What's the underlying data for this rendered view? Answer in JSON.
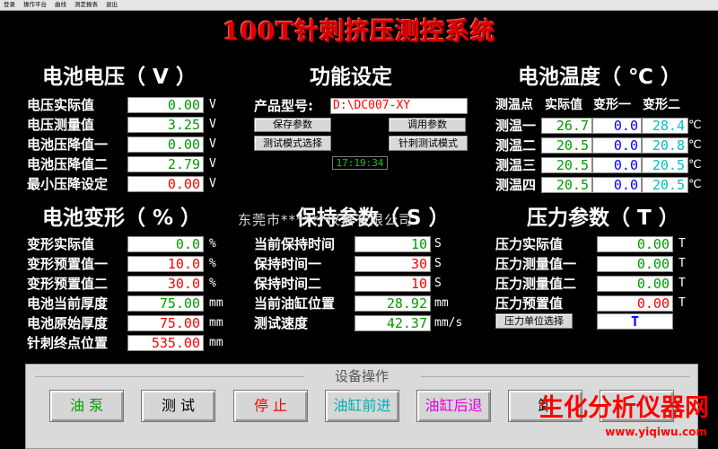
{
  "menu": [
    "登录",
    "操作平台",
    "曲线",
    "测定报表",
    "退出"
  ],
  "title": "100T针刺挤压测控系统",
  "voltage": {
    "title": "电池电压（ V ）",
    "rows": [
      {
        "label": "电压实际值",
        "value": "0.00",
        "unit": "V"
      },
      {
        "label": "电压测量值",
        "value": "3.25",
        "unit": "V"
      },
      {
        "label": "电池压降值一",
        "value": "0.00",
        "unit": "V"
      },
      {
        "label": "电池压降值二",
        "value": "2.79",
        "unit": "V"
      },
      {
        "label": "最小压降设定",
        "value": "0.00",
        "unit": "V"
      }
    ]
  },
  "function": {
    "title": "功能设定",
    "model_label": "产品型号:",
    "model_value": "D:\\DC007-XY",
    "save_button": "保存参数",
    "load_button": "调用参数",
    "test_mode_select": "测试模式选择",
    "test_mode_value": "针刺测试模式",
    "clock": "17:19:34"
  },
  "temperature": {
    "title": "电池温度（ ℃ ）",
    "headers": [
      "测温点",
      "实际值",
      "变形一",
      "变形二"
    ],
    "unit": "℃",
    "rows": [
      {
        "label": "测温一",
        "actual": "26.7",
        "deform1": "0.0",
        "deform2": "28.4"
      },
      {
        "label": "测温二",
        "actual": "20.5",
        "deform1": "0.0",
        "deform2": "20.8"
      },
      {
        "label": "测温三",
        "actual": "20.5",
        "deform1": "0.0",
        "deform2": "20.5"
      },
      {
        "label": "测温四",
        "actual": "20.5",
        "deform1": "0.0",
        "deform2": "20.5"
      }
    ]
  },
  "deformation": {
    "title": "电池变形（ % ）",
    "rows": [
      {
        "label": "变形实际值",
        "value": "0.0",
        "unit": "%"
      },
      {
        "label": "变形预置值一",
        "value": "10.0",
        "unit": "%"
      },
      {
        "label": "变形预置值二",
        "value": "30.0",
        "unit": "%"
      },
      {
        "label": "电池当前厚度",
        "value": "75.00",
        "unit": "mm"
      },
      {
        "label": "电池原始厚度",
        "value": "75.00",
        "unit": "mm"
      },
      {
        "label": "针刺终点位置",
        "value": "535.00",
        "unit": "mm"
      }
    ]
  },
  "hold": {
    "title": "保持参数（ S ）",
    "rows": [
      {
        "label": "当前保持时间",
        "value": "10",
        "unit": "S"
      },
      {
        "label": "保持时间一",
        "value": "30",
        "unit": "S"
      },
      {
        "label": "保持时间二",
        "value": "10",
        "unit": "S"
      },
      {
        "label": "当前油缸位置",
        "value": "28.92",
        "unit": "mm"
      },
      {
        "label": "测试速度",
        "value": "42.37",
        "unit": "mm/s"
      }
    ]
  },
  "pressure": {
    "title": "压力参数（ T ）",
    "rows": [
      {
        "label": "压力实际值",
        "value": "0.00",
        "unit": "T"
      },
      {
        "label": "压力测量值一",
        "value": "0.00",
        "unit": "T"
      },
      {
        "label": "压力测量值二",
        "value": "0.00",
        "unit": "T"
      },
      {
        "label": "压力预置值",
        "value": "0.00",
        "unit": "T"
      }
    ],
    "unit_select": "压力单位选择",
    "unit_value": "T"
  },
  "watermark": "东莞市******仪器有限公司",
  "operations": {
    "title": "设备操作",
    "buttons": [
      {
        "label": "油 泵",
        "color": "#00a000"
      },
      {
        "label": "测 试",
        "color": "#000000"
      },
      {
        "label": "停 止",
        "color": "#ff0000"
      },
      {
        "label": "油缸前进",
        "color": "#00b0b0"
      },
      {
        "label": "油缸后退",
        "color": "#e000e0"
      },
      {
        "label": "卸",
        "color": "#000000"
      }
    ]
  },
  "logo": {
    "text": "生化分析仪器网",
    "url": "www.yiqiwu.com",
    "color": "#ff0000"
  }
}
